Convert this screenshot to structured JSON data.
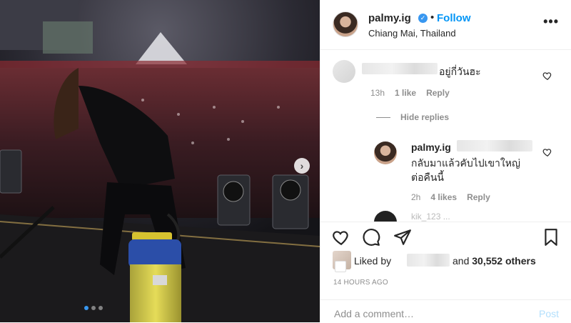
{
  "post": {
    "username": "palmy.ig",
    "follow_label": "Follow",
    "dot": "•",
    "location": "Chiang Mai, Thailand",
    "more_label": "•••"
  },
  "comments": [
    {
      "text": "อยู่กี่วันฮะ",
      "time": "13h",
      "likes": "1 like",
      "reply": "Reply"
    }
  ],
  "hide_replies": "Hide replies",
  "reply": {
    "username": "palmy.ig",
    "text_line1": "กลับมาแล้วคับไปเขาใหญ่",
    "text_line2": "ต่อคืนนี้",
    "time": "2h",
    "likes": "4 likes",
    "reply": "Reply"
  },
  "partial_comment": "kik_123 ...",
  "likes": {
    "prefix": "Liked by",
    "rest_and": "and",
    "count": "30,552 others"
  },
  "timestamp": "14 HOURS AGO",
  "add_comment": {
    "placeholder": "Add a comment…",
    "post_label": "Post"
  },
  "carousel": {
    "next_icon": "›",
    "total_slides": 3,
    "active_slide": 1
  },
  "colors": {
    "accent": "#0095f6",
    "verified": "#3897f0",
    "muted": "#8e8e8e"
  }
}
